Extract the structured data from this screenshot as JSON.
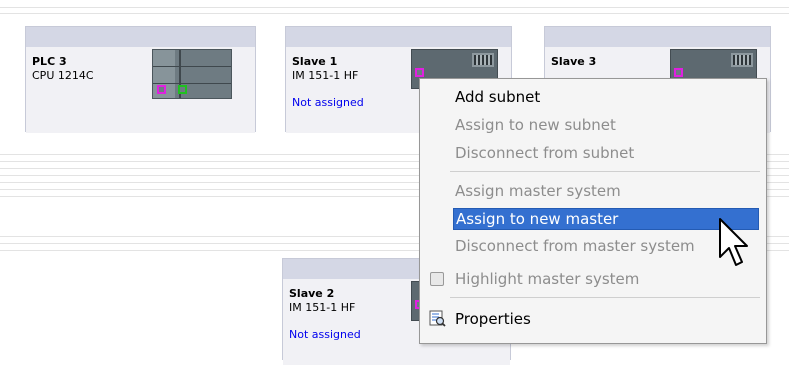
{
  "devices": [
    {
      "name": "PLC 3",
      "type": "CPU 1214C",
      "status": ""
    },
    {
      "name": "Slave 1",
      "type": "IM 151-1 HF",
      "status": "Not assigned"
    },
    {
      "name": "Slave 3",
      "type": "",
      "status": ""
    },
    {
      "name": "Slave 2",
      "type": "IM 151-1 HF",
      "status": "Not assigned"
    }
  ],
  "context_menu": {
    "items": [
      {
        "label": "Add subnet",
        "state": "enabled"
      },
      {
        "label": "Assign to new subnet",
        "state": "disabled"
      },
      {
        "label": "Disconnect from subnet",
        "state": "disabled"
      },
      {
        "label": "Assign master system",
        "state": "disabled"
      },
      {
        "label": "Assign to new master",
        "state": "highlighted"
      },
      {
        "label": "Disconnect from master system",
        "state": "disabled"
      },
      {
        "label": "Highlight master system",
        "state": "disabled",
        "checkbox": false
      },
      {
        "label": "Properties",
        "state": "enabled",
        "icon": "properties-icon"
      }
    ]
  },
  "colors": {
    "highlight": "#3470d0",
    "link_status": "#0000ee",
    "port_magenta": "#e020e0",
    "port_green": "#20c020"
  }
}
